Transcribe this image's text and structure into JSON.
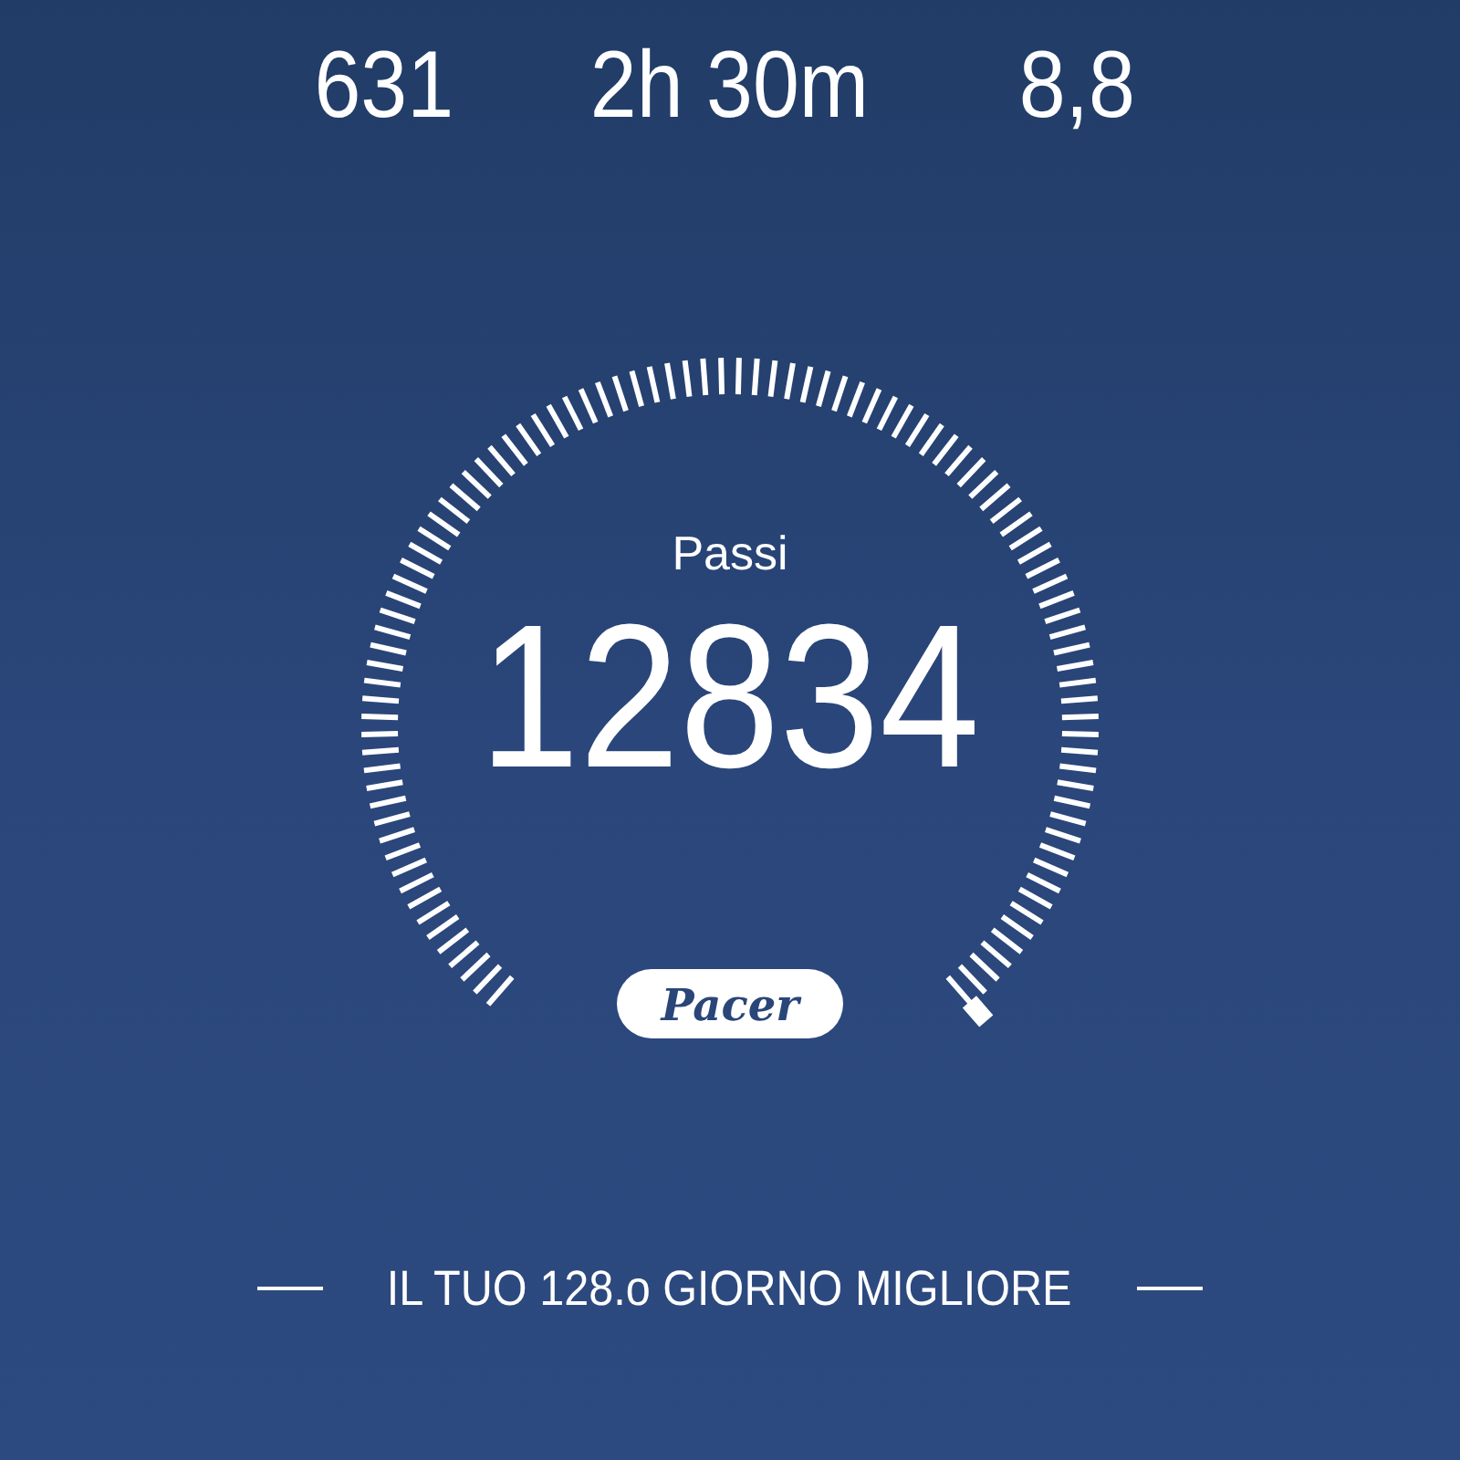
{
  "stats": [
    {
      "value": "631"
    },
    {
      "value": "2h 30m"
    },
    {
      "value": "8,8"
    }
  ],
  "gauge": {
    "label": "Passi",
    "value": "12834"
  },
  "badge": {
    "text": "Pacer"
  },
  "footer": {
    "text": "IL TUO 128.o GIORNO MIGLIORE"
  }
}
